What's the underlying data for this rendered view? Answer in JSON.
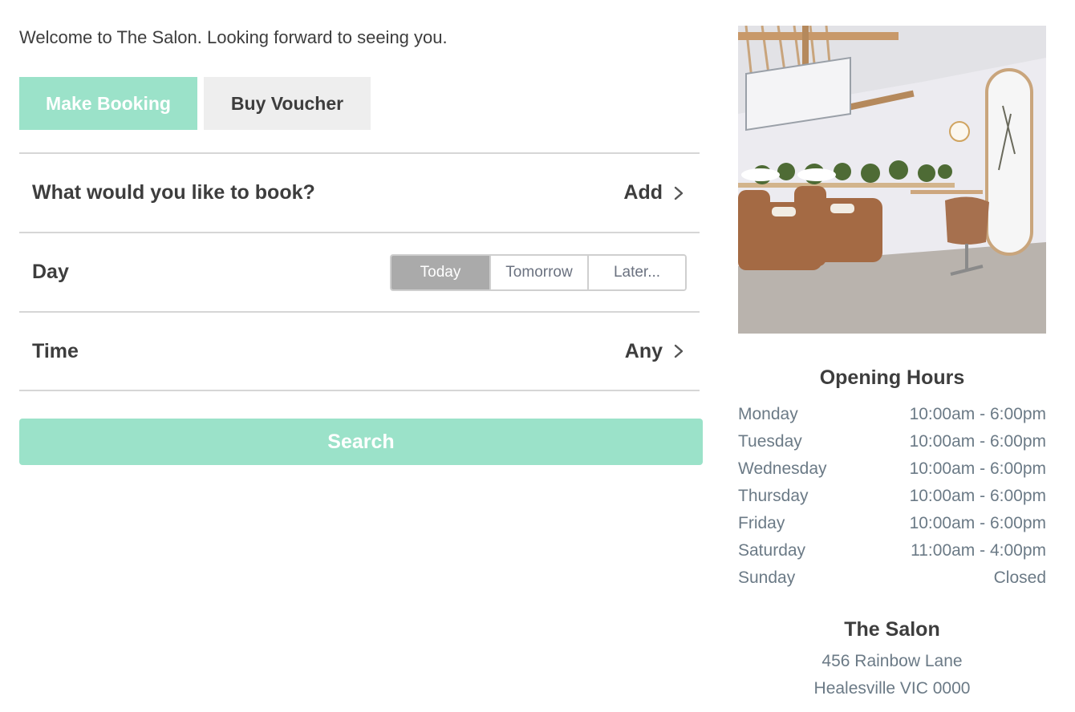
{
  "welcome_text": "Welcome to The Salon. Looking forward to seeing you.",
  "tabs": [
    {
      "label": "Make Booking",
      "active": true
    },
    {
      "label": "Buy Voucher",
      "active": false
    }
  ],
  "booking": {
    "service": {
      "label": "What would you like to book?",
      "action": "Add"
    },
    "day": {
      "label": "Day",
      "options": [
        "Today",
        "Tomorrow",
        "Later..."
      ],
      "selected": "Today"
    },
    "time": {
      "label": "Time",
      "action": "Any"
    }
  },
  "search_label": "Search",
  "opening_hours": {
    "title": "Opening Hours",
    "days": [
      {
        "day": "Monday",
        "hours": "10:00am - 6:00pm"
      },
      {
        "day": "Tuesday",
        "hours": "10:00am - 6:00pm"
      },
      {
        "day": "Wednesday",
        "hours": "10:00am - 6:00pm"
      },
      {
        "day": "Thursday",
        "hours": "10:00am - 6:00pm"
      },
      {
        "day": "Friday",
        "hours": "10:00am - 6:00pm"
      },
      {
        "day": "Saturday",
        "hours": "11:00am - 4:00pm"
      },
      {
        "day": "Sunday",
        "hours": "Closed"
      }
    ]
  },
  "business": {
    "name": "The Salon",
    "address_line1": "456 Rainbow Lane",
    "address_line2": "Healesville VIC 0000"
  },
  "colors": {
    "accent": "#9be2c9",
    "text_dark": "#3d3d3d",
    "text_muted": "#6b7a86",
    "selected_segment": "#aaaaaa"
  }
}
